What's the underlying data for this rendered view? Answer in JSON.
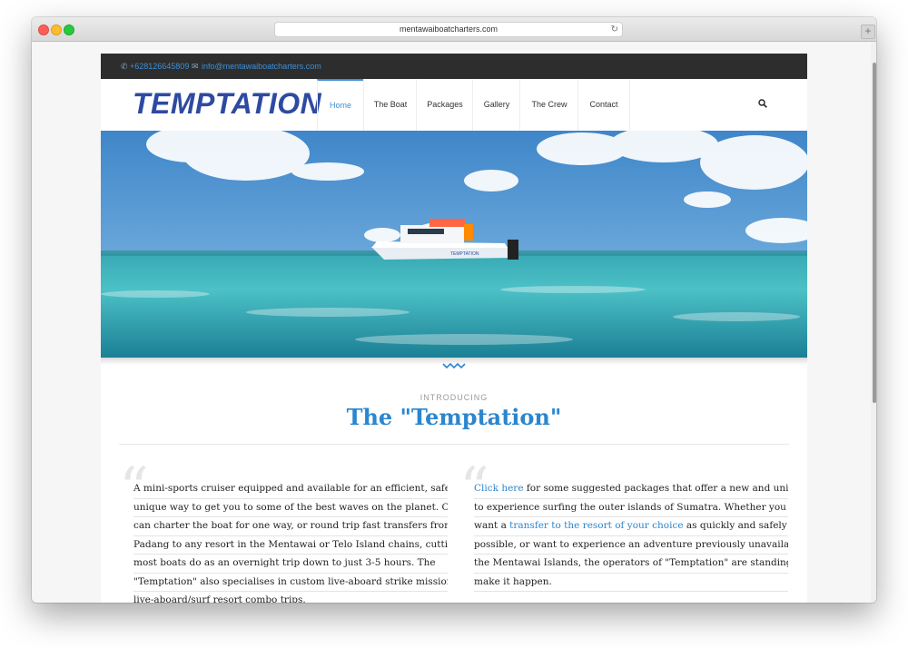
{
  "browser": {
    "url": "mentawaiboatcharters.com",
    "new_tab_label": "+"
  },
  "topbar": {
    "phone": "+628126645809",
    "email": "info@mentawaiboatcharters.com"
  },
  "header": {
    "logo": "TEMPTATION",
    "nav": [
      "Home",
      "The Boat",
      "Packages",
      "Gallery",
      "The Crew",
      "Contact"
    ],
    "active_nav": "Home"
  },
  "hero": {
    "boat_name": "TEMPTATION"
  },
  "intro": {
    "label": "INTRODUCING",
    "headline": "The \"Temptation\""
  },
  "left_column": {
    "lines": [
      "A mini-sports cruiser equipped and available for an efficient, safe, and",
      "unique way to get you to some of the best waves on the planet. Clients",
      "can charter the boat for one way, or round trip fast transfers from",
      "Padang to any resort in the Mentawai or Telo Island chains, cutting what",
      "most boats do as an overnight trip down to just 3-5 hours. The",
      "\"Temptation\" also specialises in custom live-aboard strike missions and",
      "live-aboard/surf resort combo trips."
    ]
  },
  "right_column": {
    "link1": "Click here",
    "line1_rest": " for some suggested packages that offer a new and unique way",
    "line2": "to experience surfing the outer islands of Sumatra. Whether you just",
    "line3_pre": "want a ",
    "link2": "transfer to the resort of your choice",
    "line3_post": " as quickly and safely as",
    "line4": "possible, or want to experience an adventure previously unavailable in",
    "line5": "the Mentawai Islands, the operators of \"Temptation\" are standing by to",
    "line6": "make it happen."
  },
  "colors": {
    "accent": "#2b86cf",
    "logo": "#2e4aa0",
    "topbar": "#2d2d2d"
  }
}
